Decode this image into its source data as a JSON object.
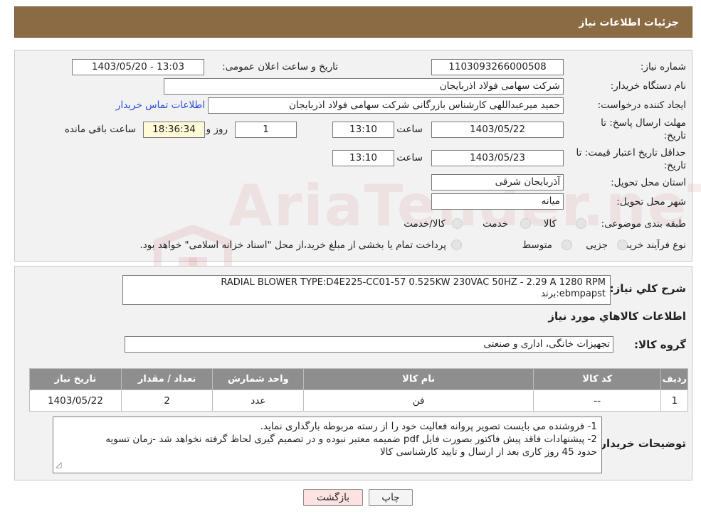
{
  "header": {
    "title": "جزئیات اطلاعات نیاز"
  },
  "form": {
    "need_number_label": "شماره نیاز:",
    "need_number": "1103093266000508",
    "announce_label": "تاریخ و ساعت اعلان عمومی:",
    "announce_value": "1403/05/20 - 13:03",
    "buyer_org_label": "نام دستگاه خریدار:",
    "buyer_org": "شرکت سهامی فولاد اذربایجان",
    "creator_label": "ایجاد کننده درخواست:",
    "creator": "حمید میرعبداللهی کارشناس بازرگانی شرکت سهامی فولاد اذربایجان",
    "contact_link": "اطلاعات تماس خریدار",
    "reply_deadline_label_1": "مهلت ارسال پاسخ: تا",
    "reply_deadline_label_2": "تاریخ:",
    "reply_date": "1403/05/22",
    "time_label": "ساعت",
    "reply_time": "13:10",
    "days_value": "1",
    "days_label": "روز و",
    "remaining_time": "18:36:34",
    "remaining_label": "ساعت باقی مانده",
    "price_valid_label_1": "حداقل تاریخ اعتبار قیمت: تا",
    "price_valid_label_2": "تاریخ:",
    "price_valid_date": "1403/05/23",
    "price_valid_time": "13:10",
    "province_label": "استان محل تحویل:",
    "province": "آذربایجان شرقی",
    "city_label": "شهر محل تحویل:",
    "city": "میانه",
    "category_label": "طبقه بندی موضوعی:",
    "category_options": [
      "کالا",
      "خدمت",
      "کالا/خدمت"
    ],
    "process_label": "نوع فرآیند خرید :",
    "process_options": [
      "جزیی",
      "متوسط"
    ],
    "process_note": "پرداخت تمام یا بخشی از مبلغ خرید،از محل \"اسناد خزانه اسلامی\" خواهد بود."
  },
  "watermark": {
    "text": "AriaTender.neT"
  },
  "details": {
    "summary_label": "شرح کلي نیاز:",
    "summary_line1": "RADIAL BLOWER TYPE:D4E225-CC01-57 0.525KW 230VAC 50HZ - 2.29 A 1280 RPM",
    "summary_line2": "برند:ebmpapst",
    "items_title": "اطلاعات کالاهاي مورد نیاز",
    "group_label": "گروه کالا:",
    "group_value": "تجهیزات خانگی، اداری و صنعتی",
    "table": {
      "headers": [
        "ردیف",
        "کد کالا",
        "نام کالا",
        "واحد شمارش",
        "تعداد / مقدار",
        "تاریخ نیاز"
      ],
      "rows": [
        [
          "1",
          "--",
          "فن",
          "عدد",
          "2",
          "1403/05/22"
        ]
      ]
    },
    "notes_label": "توضیحات خریدار:",
    "notes_line1": "1- فروشنده می بایست تصویر پروانه فعالیت خود را از رسته مربوطه بارگذاری نماید.",
    "notes_line2": "2- پیشنهادات فاقد پیش فاکتور بصورت فایل pdf  ضمیمه معتبر نبوده و در تصمیم گیری لحاظ گرفته نخواهد شد -زمان تسویه",
    "notes_line3": "حدود 45  روز کاری بعد از ارسال و تایید کارشناسی کالا"
  },
  "buttons": {
    "print": "چاپ",
    "back": "بازگشت"
  }
}
